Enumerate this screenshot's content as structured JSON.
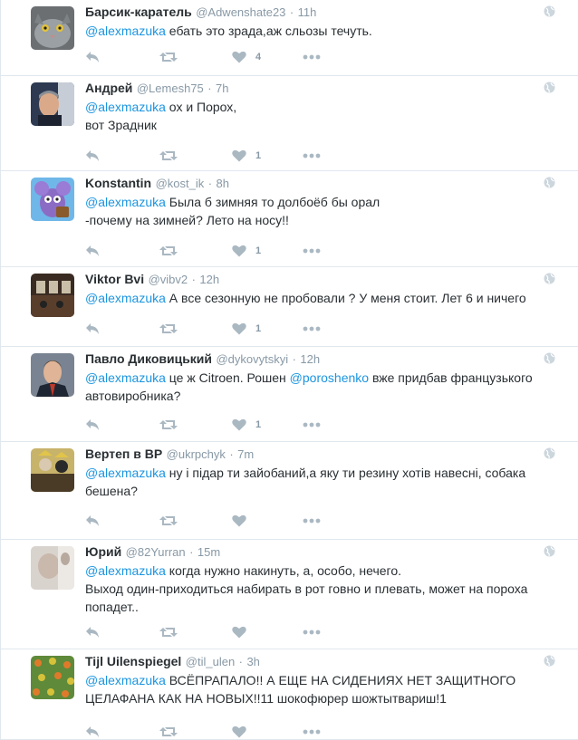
{
  "tweets": [
    {
      "name": "Барсик-каратель",
      "handle": "@Adwenshate23",
      "time": "11h",
      "lines": [
        [
          "@alexmazuka",
          " ебать это зрада,аж сльозы течуть."
        ]
      ],
      "likes": "4"
    },
    {
      "name": "Андрей",
      "handle": "@Lemesh75",
      "time": "7h",
      "lines": [
        [
          "@alexmazuka",
          " ох и Порох,"
        ],
        [
          "",
          " вот Зрадник"
        ]
      ],
      "likes": "1"
    },
    {
      "name": "Konstantin",
      "handle": "@kost_ik",
      "time": "8h",
      "lines": [
        [
          "@alexmazuka",
          " Была б зимняя то долбоёб бы орал"
        ],
        [
          "",
          "-почему на зимней? Лето на носу!!"
        ]
      ],
      "likes": "1"
    },
    {
      "name": "Viktor Bvi",
      "handle": "@vibv2",
      "time": "12h",
      "lines": [
        [
          "@alexmazuka",
          " А все сезонную не пробовали ? У меня стоит. Лет 6 и ничего"
        ]
      ],
      "likes": "1"
    },
    {
      "name": "Павло Диковицький",
      "handle": "@dykovytskyi",
      "time": "12h",
      "lines": [
        [
          "@alexmazuka",
          " це ж Citroen. Рошен ",
          "@poroshenko",
          " вже придбав французького"
        ],
        [
          "",
          "автовиробника?"
        ]
      ],
      "likes": "1"
    },
    {
      "name": "Вертеп в ВР",
      "handle": "@ukrpchyk",
      "time": "7m",
      "lines": [
        [
          "@alexmazuka",
          " ну і підар ти зайобаний,а яку ти резину хотів навесні, собака"
        ],
        [
          "",
          "бешена?"
        ]
      ],
      "likes": ""
    },
    {
      "name": "Юрий",
      "handle": "@82Yurran",
      "time": "15m",
      "lines": [
        [
          "@alexmazuka",
          " когда нужно накинуть, а, особо, нечего."
        ],
        [
          "",
          "Выход один-приходиться набирать в рот говно и плевать, может на пороха"
        ],
        [
          "",
          "попадет.."
        ]
      ],
      "likes": ""
    },
    {
      "name": "Tijl Uilenspiegel",
      "handle": "@til_ulen",
      "time": "3h",
      "lines": [
        [
          "@alexmazuka",
          " ВСЁПРАПАЛО!! А ЕЩЕ НА СИДЕНИЯХ НЕТ ЗАЩИТНОГО"
        ],
        [
          "",
          "ЦЕЛАФАНА КАК НА НОВЫХ!!11 шокофюрер шожтытвариш!1"
        ]
      ],
      "likes": ""
    }
  ],
  "separator": "·",
  "icons": {
    "reply": "reply-icon",
    "retweet": "retweet-icon",
    "like": "heart-icon",
    "more": "more-icon",
    "globe": "globe-icon"
  },
  "colors": {
    "mention": "#1b95e0",
    "meta": "#8899a6",
    "icon": "#aab8c2"
  }
}
